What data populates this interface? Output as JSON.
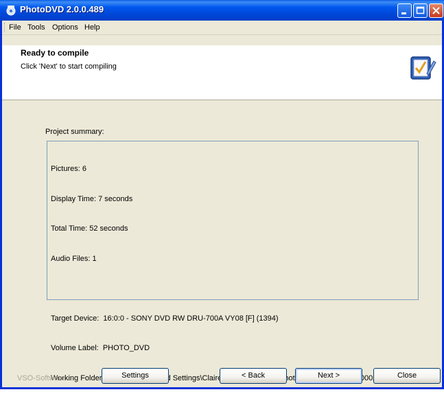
{
  "window": {
    "title": "PhotoDVD 2.0.0.489"
  },
  "menu": {
    "items": [
      "File",
      "Tools",
      "Options",
      "Help"
    ]
  },
  "header": {
    "title": "Ready to compile",
    "subtitle": "Click 'Next' to start compiling"
  },
  "summary": {
    "label": "Project summary:",
    "lines": [
      "Pictures: 6",
      "Display Time: 7 seconds",
      "Total Time: 52 seconds",
      "Audio Files: 1",
      "",
      "Target Device:  16:0:0 - SONY DVD RW DRU-700A VY08 [F] (1394)",
      "Volume Label:  PHOTO_DVD",
      "Working Folder:  C:\\Documents and Settings\\Claire\\Mes documents\\PhotoDvd\\20050511_160002"
    ]
  },
  "footer": {
    "brand": "VSO-Software",
    "settings_label": "Settings",
    "back_label": "< Back",
    "next_label": "Next >",
    "close_label": "Close"
  }
}
